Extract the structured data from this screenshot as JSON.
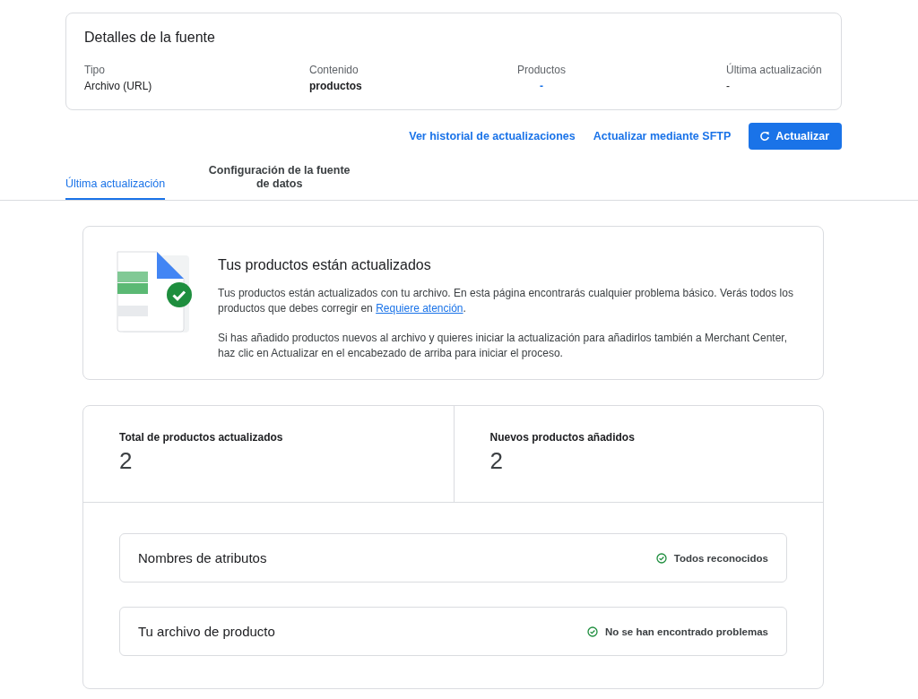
{
  "source_details": {
    "title": "Detalles de la fuente",
    "fields": [
      {
        "label": "Tipo",
        "value": "Archivo (URL)",
        "kind": "text"
      },
      {
        "label": "Contenido",
        "value": "productos",
        "kind": "bold"
      },
      {
        "label": "Productos",
        "value": "-",
        "kind": "link"
      },
      {
        "label": "Última actualización",
        "value": "-",
        "kind": "text"
      }
    ]
  },
  "actions": [
    {
      "label": "Ver historial de actualizaciones",
      "kind": "link"
    },
    {
      "label": "Actualizar mediante SFTP",
      "kind": "link"
    },
    {
      "label": "Actualizar",
      "kind": "primary"
    }
  ],
  "tabs": [
    {
      "label": "Última actualización",
      "selected": true
    },
    {
      "label": "Configuración de la fuente de datos",
      "selected": false
    }
  ],
  "status_card": {
    "title": "Tus productos están actualizados",
    "paragraph_1": {
      "text": "Tus productos están actualizados con tu archivo. En esta página encontrarás cualquier problema básico. Verás todos los productos que debes corregir en",
      "link": "Requiere atención",
      "after": "."
    },
    "paragraph_2": "Si has añadido productos nuevos al archivo y quieres iniciar la actualización para añadirlos también a Merchant Center, haz clic en Actualizar en el encabezado de arriba para iniciar el proceso."
  },
  "stats": [
    {
      "label": "Total de productos actualizados",
      "value": "2"
    },
    {
      "label": "Nuevos productos añadidos",
      "value": "2"
    }
  ],
  "checks": [
    {
      "title": "Nombres de atributos",
      "status": "Todos reconocidos",
      "ok": true
    },
    {
      "title": "Tu archivo de producto",
      "status": "No se han encontrado problemas",
      "ok": true
    }
  ]
}
